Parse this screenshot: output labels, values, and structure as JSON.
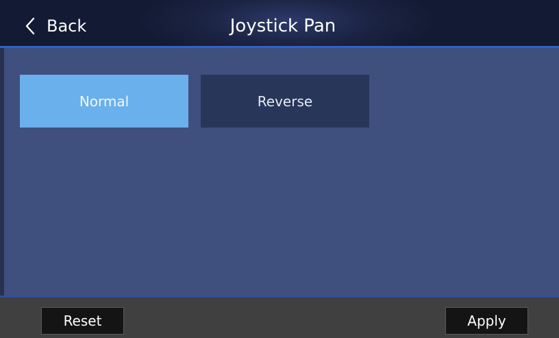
{
  "header": {
    "back_label": "Back",
    "back_icon": "chevron-left-icon",
    "title": "Joystick Pan"
  },
  "options": {
    "normal_label": "Normal",
    "reverse_label": "Reverse",
    "selected": "Normal"
  },
  "footer": {
    "reset_label": "Reset",
    "apply_label": "Apply"
  },
  "colors": {
    "background": "#3f4f7e",
    "header": "#1c2444",
    "accent_line": "#2f62c9",
    "selected_option": "#6ab0ec",
    "unselected_option": "#283659",
    "footer": "#404040",
    "footer_button": "#141414"
  }
}
